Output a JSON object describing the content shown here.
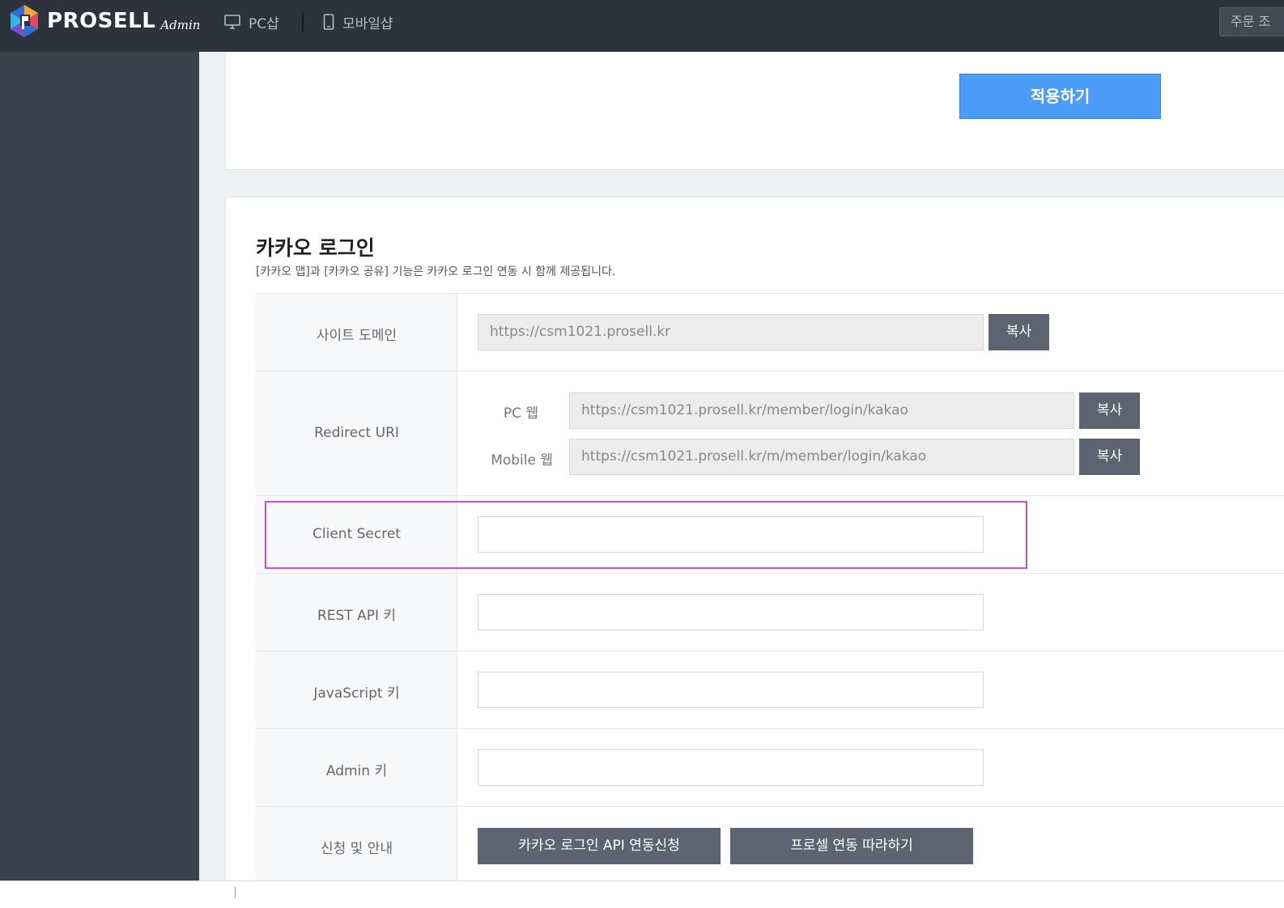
{
  "header": {
    "logo_text": "PROSELL",
    "logo_sub": "Admin",
    "nav": [
      {
        "label": "PC샵",
        "icon": "monitor-icon"
      },
      {
        "label": "모바일샵",
        "icon": "mobile-icon"
      }
    ],
    "order_button": "주문 조"
  },
  "top_card": {
    "apply_label": "적용하기"
  },
  "kakao": {
    "title": "카카오 로그인",
    "description": "[카카오 맵]과 [카카오 공유] 기능은 카카오 로그인 연동 시 함께 제공됩니다.",
    "site_domain": {
      "label": "사이트 도메인",
      "value": "https://csm1021.prosell.kr",
      "copy_label": "복사"
    },
    "redirect_uri": {
      "label": "Redirect URI",
      "pc_label": "PC 웹",
      "pc_value": "https://csm1021.prosell.kr/member/login/kakao",
      "mobile_label": "Mobile 웹",
      "mobile_value": "https://csm1021.prosell.kr/m/member/login/kakao",
      "copy_label": "복사"
    },
    "client_secret": {
      "label": "Client Secret",
      "value": ""
    },
    "rest_api_key": {
      "label": "REST API 키",
      "value": ""
    },
    "javascript_key": {
      "label": "JavaScript 키",
      "value": ""
    },
    "admin_key": {
      "label": "Admin 키",
      "value": ""
    },
    "apply_guide": {
      "label": "신청 및 안내",
      "api_request_label": "카카오 로그인 API 연동신청",
      "follow_label": "프로셀 연동 따라하기"
    }
  },
  "colors": {
    "topbar": "#2c333d",
    "sidebar": "#3a424d",
    "apply_button": "#4a9cf6",
    "gray_button": "#5b6470",
    "highlight": "#d14bd4"
  }
}
